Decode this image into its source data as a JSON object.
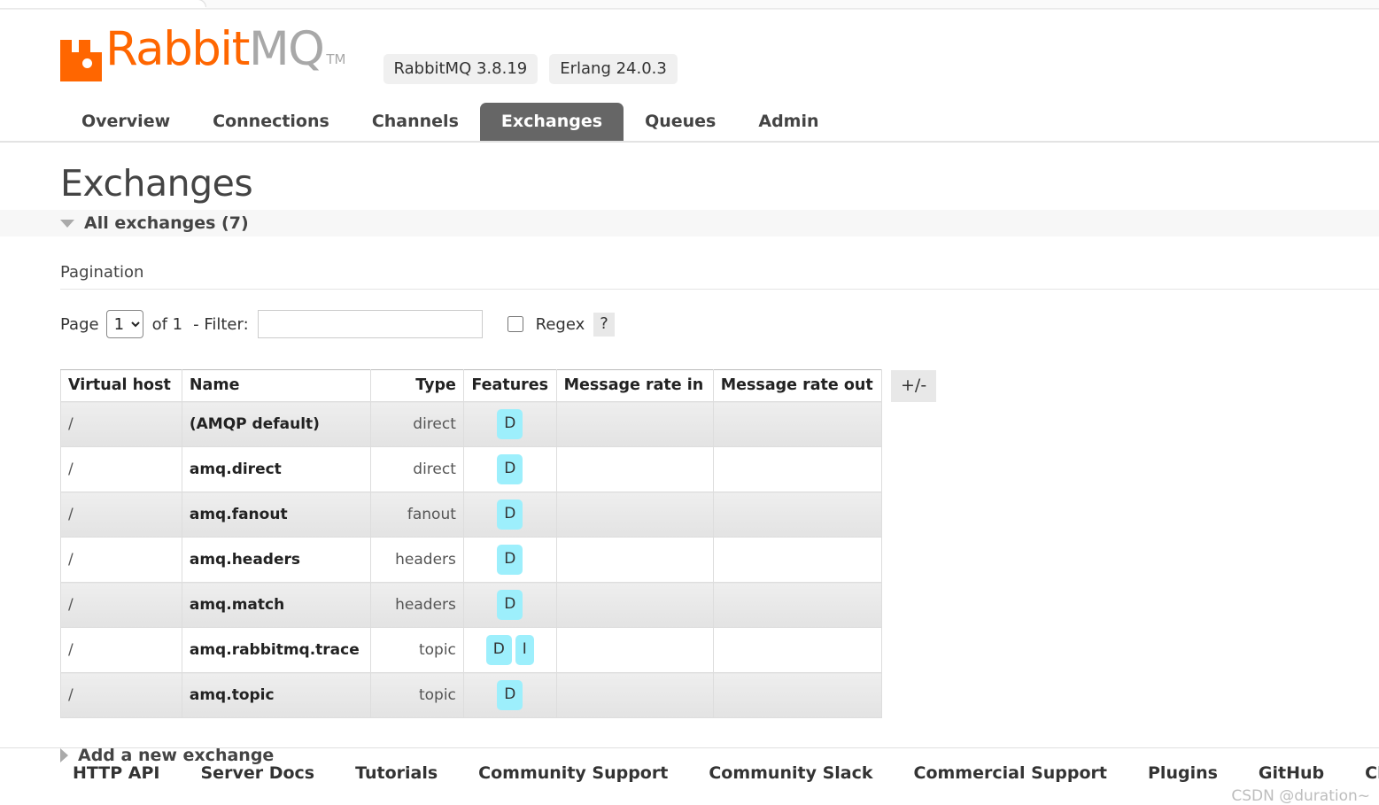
{
  "browser": {
    "chrome_visible": true
  },
  "header": {
    "logo": {
      "icon": "rabbit-head-icon",
      "text_primary": "Rabbit",
      "text_secondary": "MQ",
      "trademark": "TM",
      "color_primary": "#ff6600",
      "color_secondary": "#a8a8a8"
    },
    "badges": [
      {
        "label": "RabbitMQ 3.8.19"
      },
      {
        "label": "Erlang 24.0.3"
      }
    ]
  },
  "nav": {
    "active": "Exchanges",
    "tabs": [
      {
        "label": "Overview",
        "active": false
      },
      {
        "label": "Connections",
        "active": false
      },
      {
        "label": "Channels",
        "active": false
      },
      {
        "label": "Exchanges",
        "active": true
      },
      {
        "label": "Queues",
        "active": false
      },
      {
        "label": "Admin",
        "active": false
      }
    ]
  },
  "page": {
    "title": "Exchanges",
    "section_label": "All exchanges (7)",
    "section_expanded": true
  },
  "pagination": {
    "heading": "Pagination",
    "page_label": "Page",
    "page_value": "1",
    "page_options": [
      "1"
    ],
    "of_label": "of 1",
    "filter_label": "- Filter:",
    "filter_value": "",
    "filter_placeholder": "",
    "regex_label": "Regex",
    "regex_checked": false,
    "help_label": "?"
  },
  "table": {
    "columns": [
      "Virtual host",
      "Name",
      "Type",
      "Features",
      "Message rate in",
      "Message rate out"
    ],
    "toggle_columns_label": "+/-",
    "rows": [
      {
        "vhost": "/",
        "name": "(AMQP default)",
        "type": "direct",
        "features": [
          "D"
        ],
        "rate_in": "",
        "rate_out": ""
      },
      {
        "vhost": "/",
        "name": "amq.direct",
        "type": "direct",
        "features": [
          "D"
        ],
        "rate_in": "",
        "rate_out": ""
      },
      {
        "vhost": "/",
        "name": "amq.fanout",
        "type": "fanout",
        "features": [
          "D"
        ],
        "rate_in": "",
        "rate_out": ""
      },
      {
        "vhost": "/",
        "name": "amq.headers",
        "type": "headers",
        "features": [
          "D"
        ],
        "rate_in": "",
        "rate_out": ""
      },
      {
        "vhost": "/",
        "name": "amq.match",
        "type": "headers",
        "features": [
          "D"
        ],
        "rate_in": "",
        "rate_out": ""
      },
      {
        "vhost": "/",
        "name": "amq.rabbitmq.trace",
        "type": "topic",
        "features": [
          "D",
          "I"
        ],
        "rate_in": "",
        "rate_out": ""
      },
      {
        "vhost": "/",
        "name": "amq.topic",
        "type": "topic",
        "features": [
          "D"
        ],
        "rate_in": "",
        "rate_out": ""
      }
    ]
  },
  "add_exchange": {
    "label": "Add a new exchange",
    "expanded": false
  },
  "footer": {
    "links": [
      "HTTP API",
      "Server Docs",
      "Tutorials",
      "Community Support",
      "Community Slack",
      "Commercial Support",
      "Plugins",
      "GitHub",
      "Changelog"
    ],
    "watermark": "CSDN @duration~"
  },
  "colors": {
    "brand_orange": "#ff6600",
    "active_tab_bg": "#666666",
    "feature_badge_bg": "#9deffc",
    "row_alt_bg": "#e8e8e8"
  }
}
